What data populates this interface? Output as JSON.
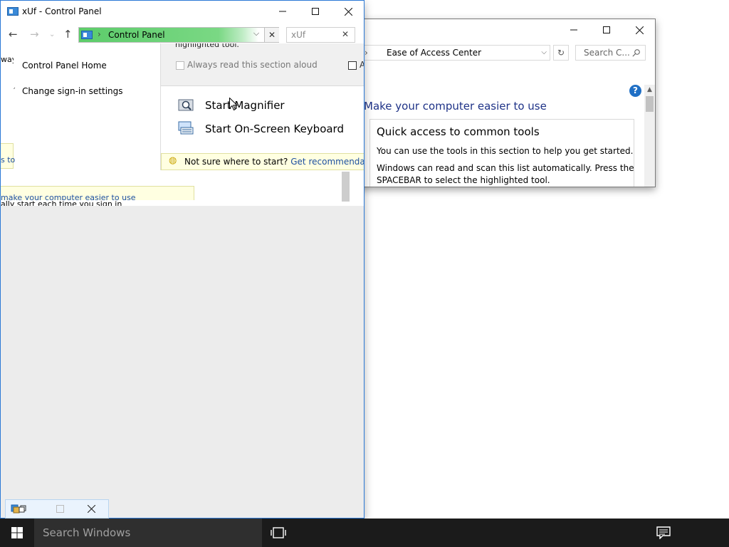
{
  "back_window": {
    "address_sep": "›",
    "address_text": "Ease of Access Center",
    "refresh_glyph": "↻",
    "search_placeholder": "Search C...",
    "help_glyph": "?",
    "heading": "Make your computer easier to use",
    "quick_access_title": "Quick access to common tools",
    "quick_access_line1": "You can use the tools in this section to help you get started.",
    "quick_access_line2": "Windows can read and scan this list automatically.  Press the",
    "quick_access_line3": "SPACEBAR to select the highlighted tool."
  },
  "front_window": {
    "title": "xUf - Control Panel",
    "breadcrumb": "Control Panel",
    "breadcrumb_sep": "›",
    "search_value": "xUf",
    "sidebar": {
      "home": "Control Panel Home",
      "signin": "Change sign-in settings"
    },
    "fragments": {
      "left_top": "way",
      "left_link": "s to",
      "left_blue_link": "make your computer easier to use",
      "left_text": "ally start each time you sign in"
    },
    "overlay": {
      "cut_heading": "highlighted tool.",
      "always_read": "Always read this section aloud",
      "right_check_label": "A",
      "magnifier": "Start Magnifier",
      "onscreen_keyboard": "Start On-Screen Keyboard",
      "tip_text": "Not sure where to start?",
      "tip_link": "Get recommendations"
    }
  },
  "taskbar": {
    "search_placeholder": "Search Windows"
  },
  "colors": {
    "accent": "#2b79d6",
    "heading_blue": "#1e3287",
    "address_green": "#5ccc6a",
    "taskbar": "#1b1b1b"
  },
  "icons": [
    "control-panel-icon",
    "back-arrow-icon",
    "forward-arrow-icon",
    "recent-dropdown-icon",
    "up-arrow-icon",
    "magnifier-icon",
    "keyboard-icon",
    "lightbulb-icon",
    "windows-logo-icon",
    "task-view-icon",
    "action-center-icon",
    "help-icon"
  ]
}
